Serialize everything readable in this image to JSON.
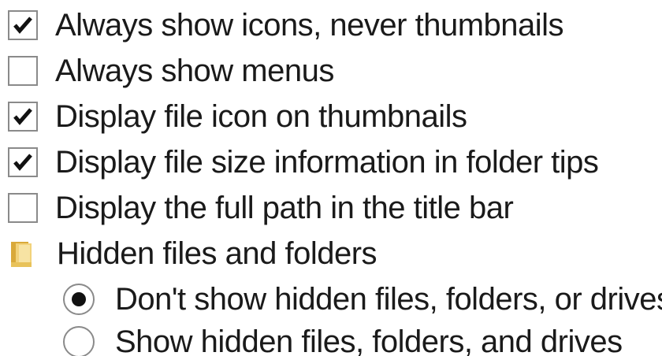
{
  "options": [
    {
      "type": "checkbox",
      "label": "Always show icons, never thumbnails",
      "checked": true
    },
    {
      "type": "checkbox",
      "label": "Always show menus",
      "checked": false
    },
    {
      "type": "checkbox",
      "label": "Display file icon on thumbnails",
      "checked": true
    },
    {
      "type": "checkbox",
      "label": "Display file size information in folder tips",
      "checked": true
    },
    {
      "type": "checkbox",
      "label": "Display the full path in the title bar",
      "checked": false
    }
  ],
  "hidden_group": {
    "label": "Hidden files and folders",
    "icon": "folder-icon",
    "radios": [
      {
        "label": "Don't show hidden files, folders, or drives",
        "selected": true
      },
      {
        "label": "Show hidden files, folders, and drives",
        "selected": false
      }
    ]
  },
  "colors": {
    "text": "#1a1a1a",
    "border": "#8a8a8a",
    "folder": "#e8c25a"
  }
}
